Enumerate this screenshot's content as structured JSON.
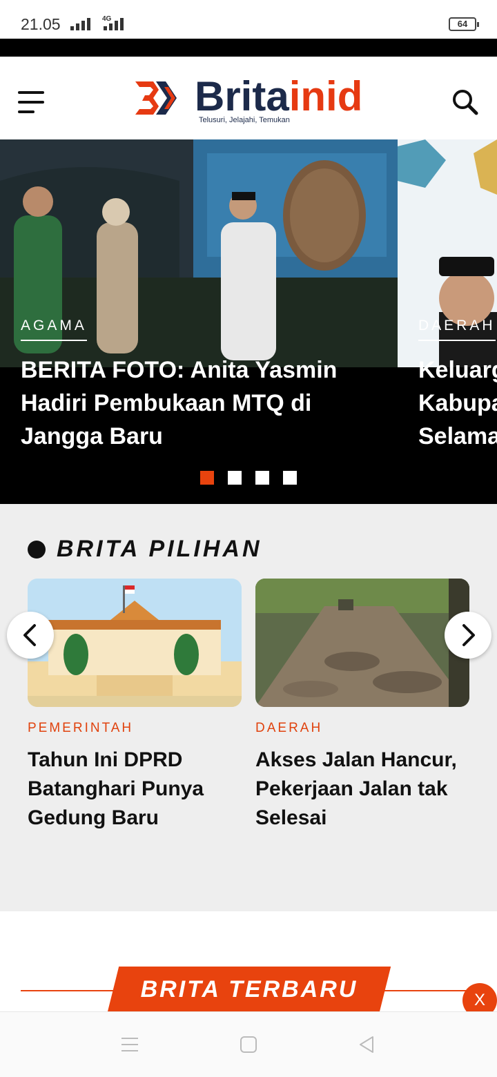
{
  "status_bar": {
    "time": "21.05",
    "network": "4G",
    "battery": "64",
    "icons": [
      "signal-icon",
      "signal-4g-icon",
      "battery-icon"
    ]
  },
  "header": {
    "logo": {
      "brand_prefix": "Brita",
      "brand_suffix": "in",
      "brand_id": "id",
      "tagline": "Telusuri, Jelajahi, Temukan"
    },
    "menu_icon": "hamburger-menu-icon",
    "search_icon": "search-icon"
  },
  "hero": {
    "slides": [
      {
        "category": "AGAMA",
        "title": "BERITA FOTO: Anita Yasmin Hadiri Pembukaan MTQ di Jangga Baru"
      },
      {
        "category": "DAERAH",
        "title": "Keluarg\nKabupa\nSelama"
      }
    ],
    "dots_total": 4,
    "active_dot": 1
  },
  "brita_pilihan": {
    "title": "BRITA PILIHAN",
    "cards": [
      {
        "category": "PEMERINTAH",
        "title": "Tahun Ini DPRD Batanghari Punya Gedung Baru"
      },
      {
        "category": "DAERAH",
        "title": "Akses Jalan Hancur, Pekerjaan Jalan tak Selesai"
      }
    ],
    "prev_icon": "chevron-left-icon",
    "next_icon": "chevron-right-icon"
  },
  "brita_terbaru": {
    "title": "BRITA TERBARU",
    "close_label": "X"
  },
  "colors": {
    "accent": "#e8430e",
    "brand_navy": "#1c2a4a",
    "section_bg": "#eeeeee"
  },
  "navbar": {
    "icons": [
      "recent-apps-icon",
      "home-icon",
      "back-icon"
    ]
  }
}
